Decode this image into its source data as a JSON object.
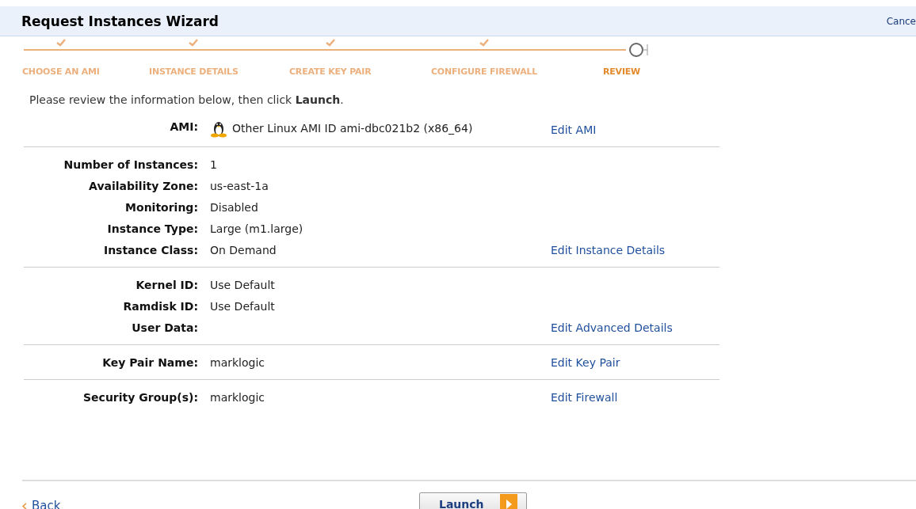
{
  "header": {
    "title": "Request Instances Wizard",
    "cancel": "Cance"
  },
  "steps": [
    {
      "label": "CHOOSE AN AMI",
      "completed": true,
      "selected": false
    },
    {
      "label": "INSTANCE DETAILS",
      "completed": true,
      "selected": false
    },
    {
      "label": "CREATE KEY PAIR",
      "completed": true,
      "selected": false
    },
    {
      "label": "CONFIGURE FIREWALL",
      "completed": true,
      "selected": false
    },
    {
      "label": "REVIEW",
      "completed": false,
      "selected": true
    }
  ],
  "intro": "Please review the information below, then click **Launch**.",
  "sections": [
    {
      "rows": [
        {
          "label": "AMI:",
          "value": "Other Linux AMI ID ami-dbc021b2 (x86_64)",
          "kind": "os"
        }
      ],
      "link": "Edit AMI"
    },
    {
      "rows": [
        {
          "label": "Number of Instances:",
          "value": "1"
        },
        {
          "label": "Availability Zone:",
          "value": "us-east-1a"
        },
        {
          "label": "Monitoring:",
          "value": "Disabled"
        },
        {
          "label": "Instance Type:",
          "value": "Large (m1.large)"
        },
        {
          "label": "Instance Class:",
          "value": "On Demand"
        }
      ],
      "link": "Edit Instance Details"
    },
    {
      "rows": [
        {
          "label": "Kernel ID:",
          "value": "Use Default"
        },
        {
          "label": "Ramdisk ID:",
          "value": "Use Default"
        },
        {
          "label": "User Data:"
        }
      ],
      "link": "Edit Advanced Details"
    },
    {
      "rows": [
        {
          "label": "Key Pair Name:",
          "value": "marklogic"
        }
      ],
      "link": "Edit Key Pair"
    },
    {
      "rows": [
        {
          "label": "Security Group(s):",
          "value": "marklogic"
        }
      ],
      "link": "Edit Firewall"
    }
  ],
  "footer": {
    "back": "Back",
    "launch": "Launch"
  }
}
